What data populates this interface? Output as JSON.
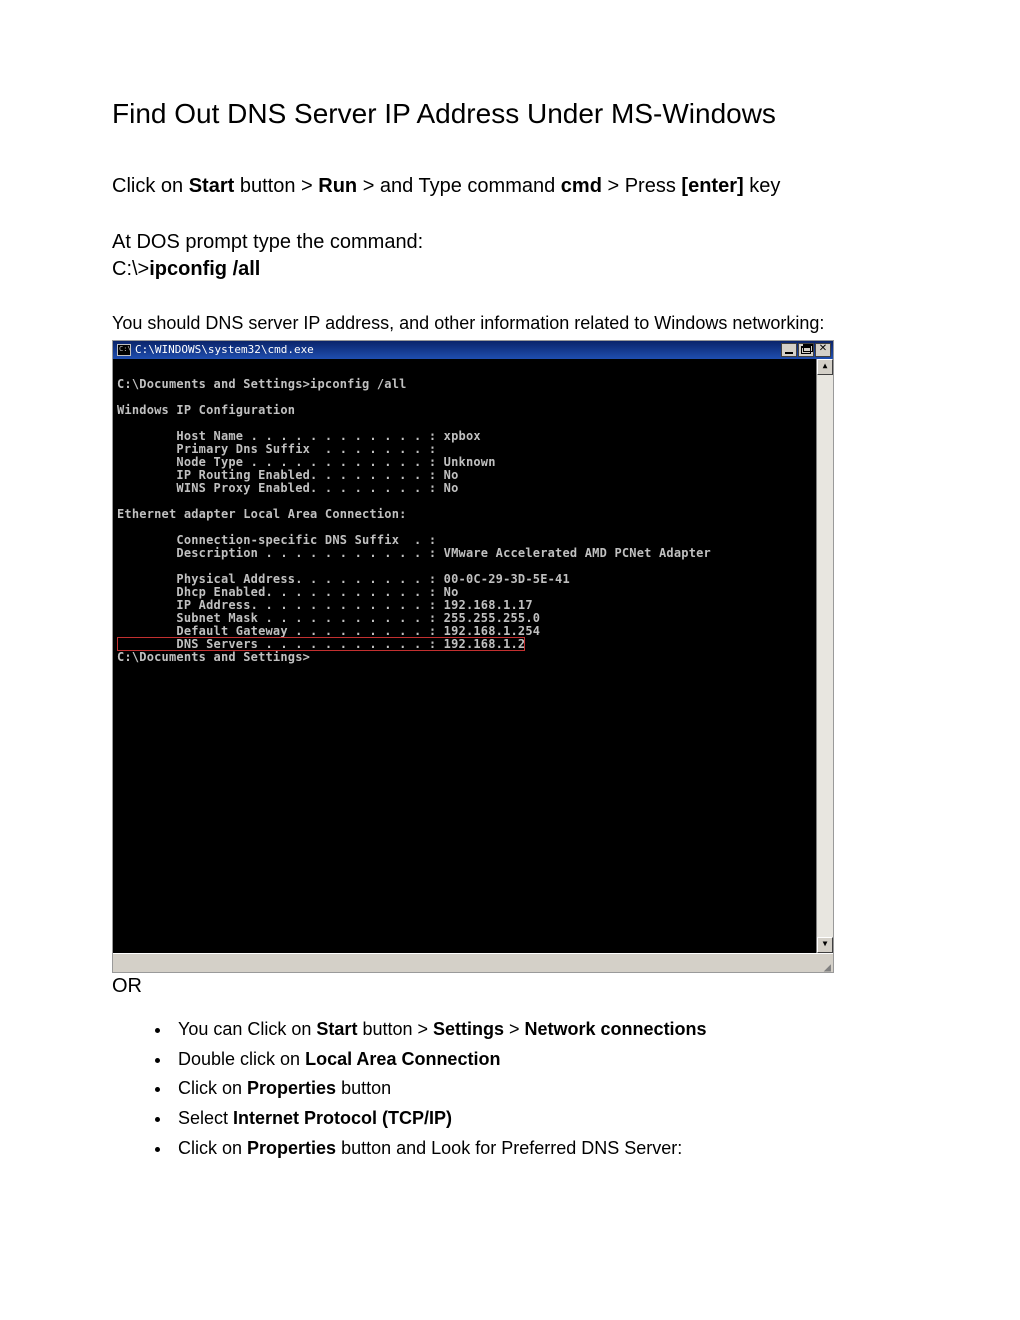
{
  "title": "Find Out DNS Server IP Address Under MS-Windows",
  "instr1": {
    "pre": "Click on ",
    "b1": "Start",
    "mid1": " button > ",
    "b2": "Run",
    "mid2": " > and Type command ",
    "b3": "cmd",
    "mid3": " > Press ",
    "b4": "[enter]",
    "post": " key"
  },
  "instr2": "At DOS prompt type the command:",
  "instr3_pre": "C:\\>",
  "instr3_cmd": "ipconfig  /all",
  "instr4": "You should DNS server IP address, and other information related to Windows networking:",
  "cmd": {
    "window_title": "C:\\WINDOWS\\system32\\cmd.exe",
    "lines_top": "\nC:\\Documents and Settings>ipconfig /all\n\nWindows IP Configuration\n\n        Host Name . . . . . . . . . . . . : xpbox\n        Primary Dns Suffix  . . . . . . . :\n        Node Type . . . . . . . . . . . . : Unknown\n        IP Routing Enabled. . . . . . . . : No\n        WINS Proxy Enabled. . . . . . . . : No\n\nEthernet adapter Local Area Connection:\n\n        Connection-specific DNS Suffix  . :\n        Description . . . . . . . . . . . : VMware Accelerated AMD PCNet Adapter\n\n        Physical Address. . . . . . . . . : 00-0C-29-3D-5E-41\n        Dhcp Enabled. . . . . . . . . . . : No\n        IP Address. . . . . . . . . . . . : 192.168.1.17\n        Subnet Mask . . . . . . . . . . . : 255.255.255.0\n        Default Gateway . . . . . . . . . : 192.168.1.254",
    "line_highlight": "        DNS Servers . . . . . . . . . . . : 192.168.1.2",
    "lines_bottom": "\nC:\\Documents and Settings>"
  },
  "or": "OR",
  "steps": [
    {
      "pre": "You can Click on ",
      "b1": "Start",
      "mid1": " button > ",
      "b2": "Settings",
      "mid2": " > ",
      "b3": "Network connections",
      "post": ""
    },
    {
      "pre": "Double click on ",
      "b1": "Local Area Connection",
      "mid1": "",
      "b2": "",
      "mid2": "",
      "b3": "",
      "post": ""
    },
    {
      "pre": "Click on ",
      "b1": "Properties",
      "mid1": " button",
      "b2": "",
      "mid2": "",
      "b3": "",
      "post": ""
    },
    {
      "pre": "Select ",
      "b1": "Internet Protocol (TCP/IP)",
      "mid1": "",
      "b2": "",
      "mid2": "",
      "b3": "",
      "post": ""
    },
    {
      "pre": "Click on ",
      "b1": "Properties",
      "mid1": " button and Look for Preferred DNS Server:",
      "b2": "",
      "mid2": "",
      "b3": "",
      "post": ""
    }
  ]
}
